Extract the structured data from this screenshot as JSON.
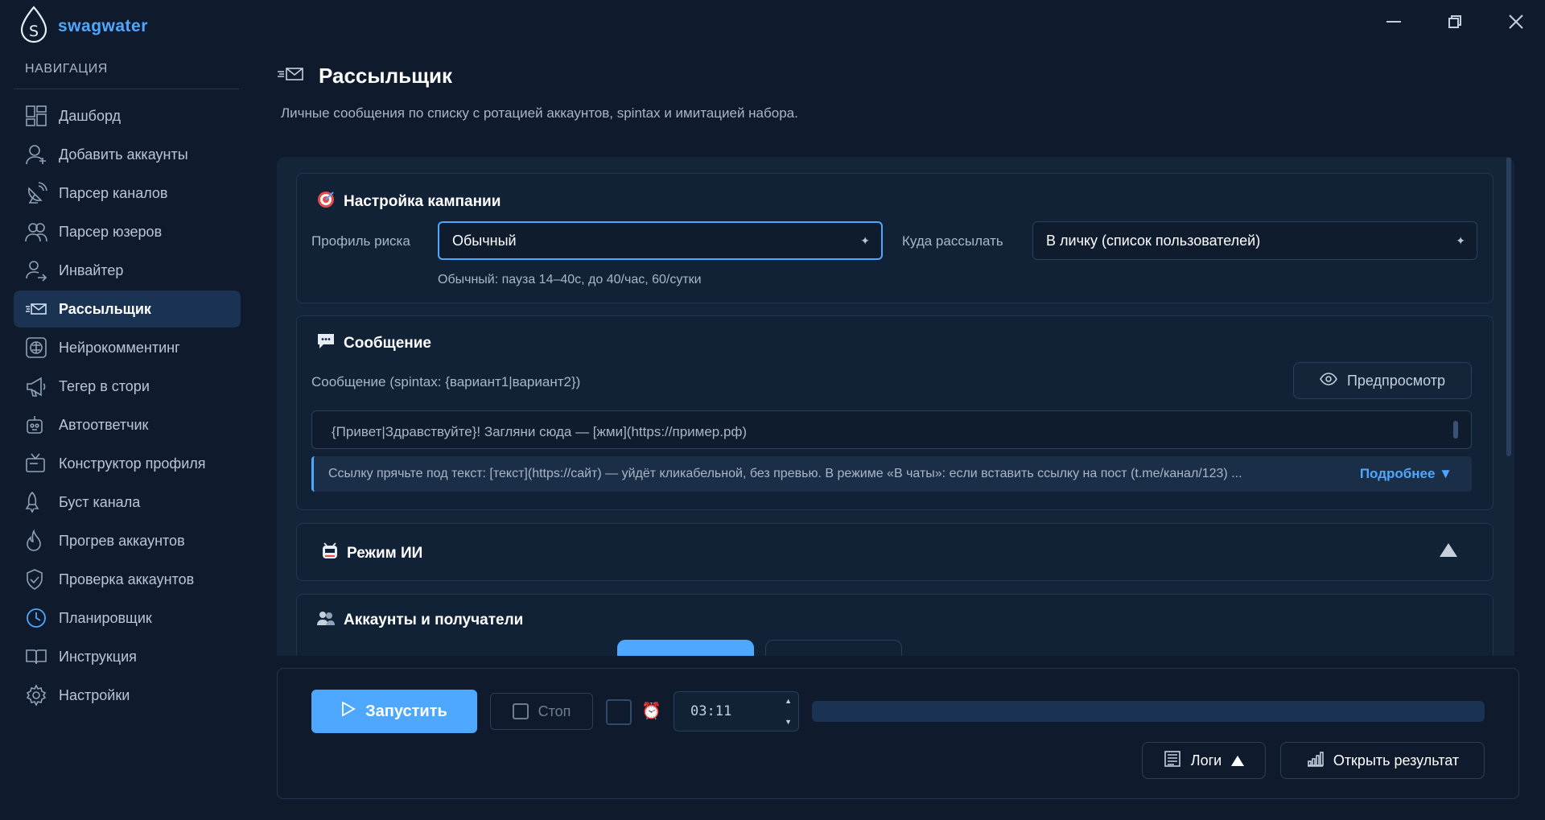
{
  "app": {
    "name": "swagwater"
  },
  "nav": {
    "title": "НАВИГАЦИЯ",
    "items": [
      {
        "label": "Дашборд",
        "icon": "dashboard-icon"
      },
      {
        "label": "Добавить аккаунты",
        "icon": "add-user-icon"
      },
      {
        "label": "Парсер каналов",
        "icon": "satellite-icon"
      },
      {
        "label": "Парсер юзеров",
        "icon": "users-icon"
      },
      {
        "label": "Инвайтер",
        "icon": "user-arrow-icon"
      },
      {
        "label": "Рассыльщик",
        "icon": "envelope-icon",
        "active": true
      },
      {
        "label": "Нейрокомментинг",
        "icon": "brain-icon"
      },
      {
        "label": "Тегер в стори",
        "icon": "megaphone-icon"
      },
      {
        "label": "Автоответчик",
        "icon": "robot-icon"
      },
      {
        "label": "Конструктор профиля",
        "icon": "tv-icon"
      },
      {
        "label": "Буст канала",
        "icon": "rocket-icon"
      },
      {
        "label": "Прогрев аккаунтов",
        "icon": "flame-icon"
      },
      {
        "label": "Проверка аккаунтов",
        "icon": "shield-icon"
      },
      {
        "label": "Планировщик",
        "icon": "clock-icon"
      },
      {
        "label": "Инструкция",
        "icon": "book-icon"
      },
      {
        "label": "Настройки",
        "icon": "gear-icon"
      }
    ]
  },
  "page": {
    "title": "Рассыльщик",
    "subtitle": "Личные сообщения по списку с ротацией аккаунтов, spintax и имитацией набора."
  },
  "campaign": {
    "title": "Настройка кампании",
    "risk_label": "Профиль риска",
    "risk_value": "Обычный",
    "target_label": "Куда рассылать",
    "target_value": "В личку (список пользователей)",
    "hint": "Обычный: пауза 14–40с, до 40/час, 60/сутки"
  },
  "message": {
    "title": "Сообщение",
    "field_label": "Сообщение (spintax: {вариант1|вариант2})",
    "preview_button": "Предпросмотр",
    "text": "{Привет|Здравствуйте}! Загляни сюда — [жми](https://пример.рф)",
    "info": "Ссылку прячьте под текст: [текст](https://сайт) — уйдёт кликабельной, без превью. В режиме «В чаты»: если вставить ссылку на пост (t.me/канал/123) ...",
    "more": "Подробнее ▼"
  },
  "ai": {
    "title": "Режим ИИ"
  },
  "accounts": {
    "title": "Аккаунты и получатели"
  },
  "controls": {
    "run": "Запустить",
    "stop": "Стоп",
    "time": "03:11",
    "progress": 0.0,
    "logs": "Логи",
    "open_result": "Открыть результат"
  },
  "colors": {
    "accent": "#4fa8ff",
    "bg": "#0f1b2d",
    "panel": "#142439",
    "active_nav": "#1b3352"
  }
}
